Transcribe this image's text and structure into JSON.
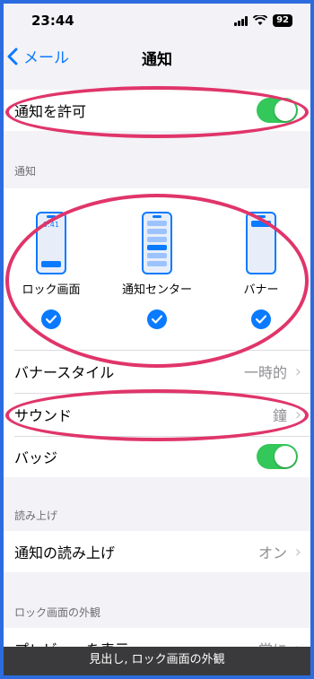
{
  "status_bar": {
    "time": "23:44",
    "battery": "92"
  },
  "nav": {
    "back_label": "メール",
    "title": "通知"
  },
  "allow": {
    "label": "通知を許可",
    "enabled": true
  },
  "alerts_section": {
    "header": "通知"
  },
  "alert_styles": [
    {
      "label": "ロック画面",
      "preview_time": "9:41",
      "checked": true
    },
    {
      "label": "通知センター",
      "checked": true
    },
    {
      "label": "バナー",
      "checked": true
    }
  ],
  "settings": {
    "banner_style": {
      "label": "バナースタイル",
      "value": "一時的"
    },
    "sound": {
      "label": "サウンド",
      "value": "鐘"
    },
    "badge": {
      "label": "バッジ",
      "enabled": true
    }
  },
  "announce_section": {
    "header": "読み上げ",
    "row_label": "通知の読み上げ",
    "row_value": "オン"
  },
  "lockscreen_section": {
    "header": "ロック画面の外観",
    "preview_label": "プレビューを表示",
    "preview_value": "常に"
  },
  "toast": "見出し, ロック画面の外観",
  "colors": {
    "accent": "#0a7aff",
    "toggle_on": "#34c759",
    "annotation": "#e0356a"
  }
}
